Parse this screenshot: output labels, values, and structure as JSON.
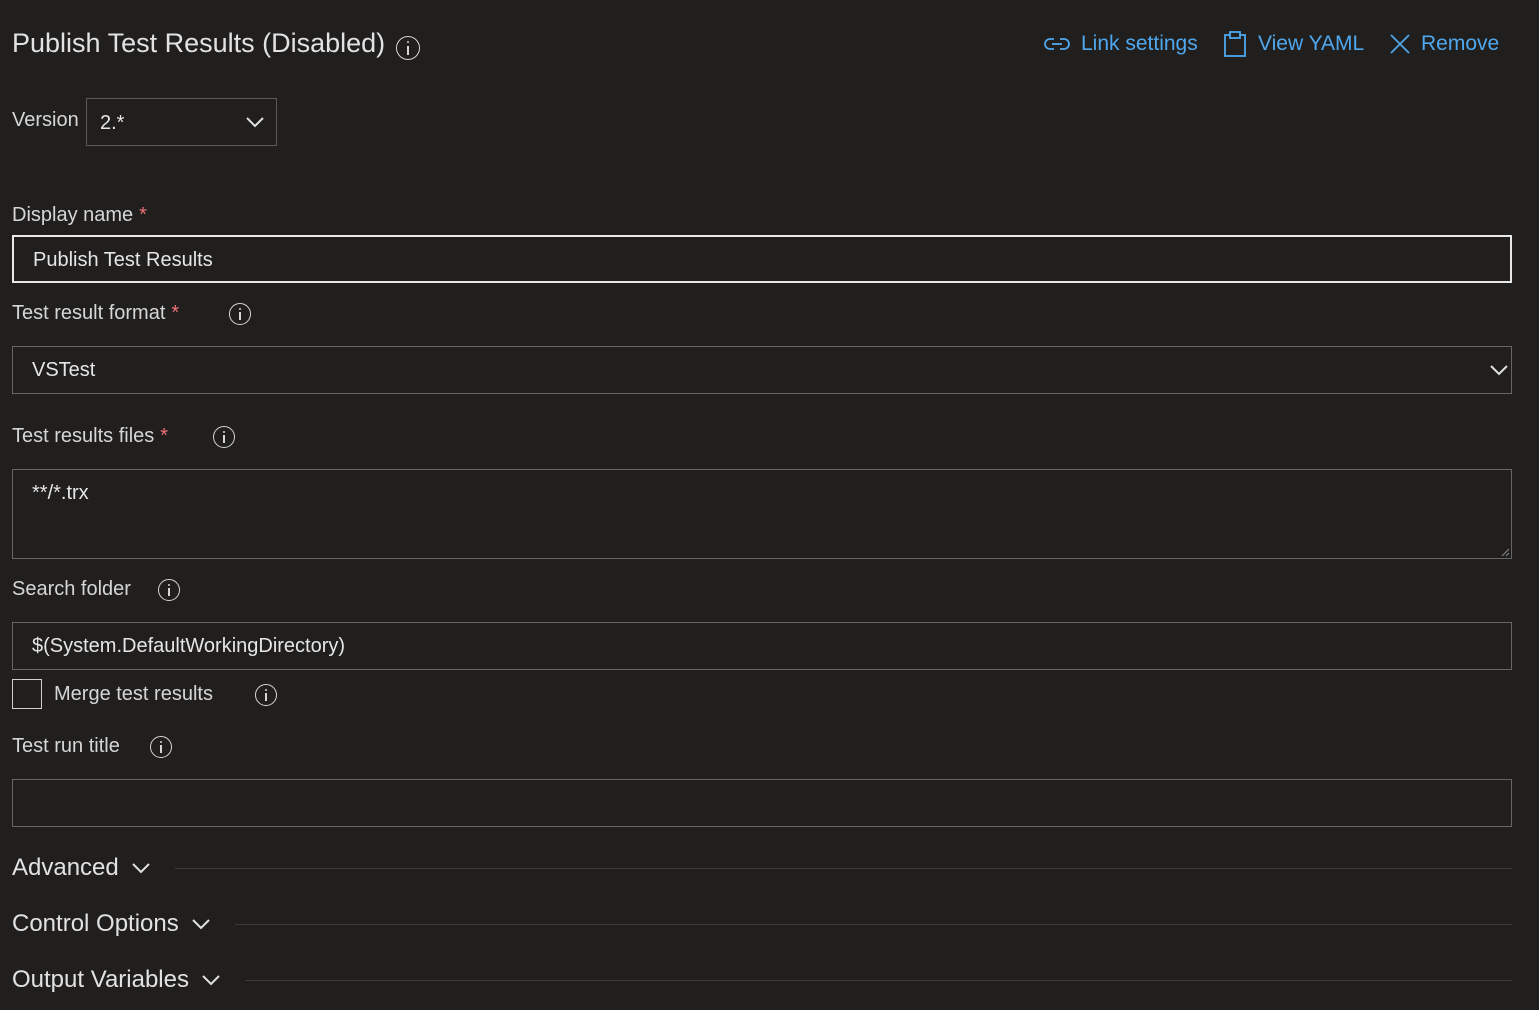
{
  "header": {
    "title": "Publish Test Results (Disabled)",
    "actions": {
      "link_settings": "Link settings",
      "view_yaml": "View YAML",
      "remove": "Remove"
    }
  },
  "version": {
    "label": "Version",
    "value": "2.*"
  },
  "display_name": {
    "label": "Display name",
    "required": "*",
    "value": "Publish Test Results"
  },
  "test_result_format": {
    "label": "Test result format",
    "required": "*",
    "value": "VSTest"
  },
  "test_results_files": {
    "label": "Test results files",
    "required": "*",
    "value": "**/*.trx"
  },
  "search_folder": {
    "label": "Search folder",
    "value": "$(System.DefaultWorkingDirectory)"
  },
  "merge_test_results": {
    "label": "Merge test results",
    "checked": false
  },
  "test_run_title": {
    "label": "Test run title",
    "value": ""
  },
  "sections": {
    "advanced": "Advanced",
    "control_options": "Control Options",
    "output_variables": "Output Variables"
  },
  "colors": {
    "background": "#201f1e",
    "accent_link": "#4fa7ee",
    "required_marker": "#f1707b",
    "text": "#d6d6d6"
  }
}
